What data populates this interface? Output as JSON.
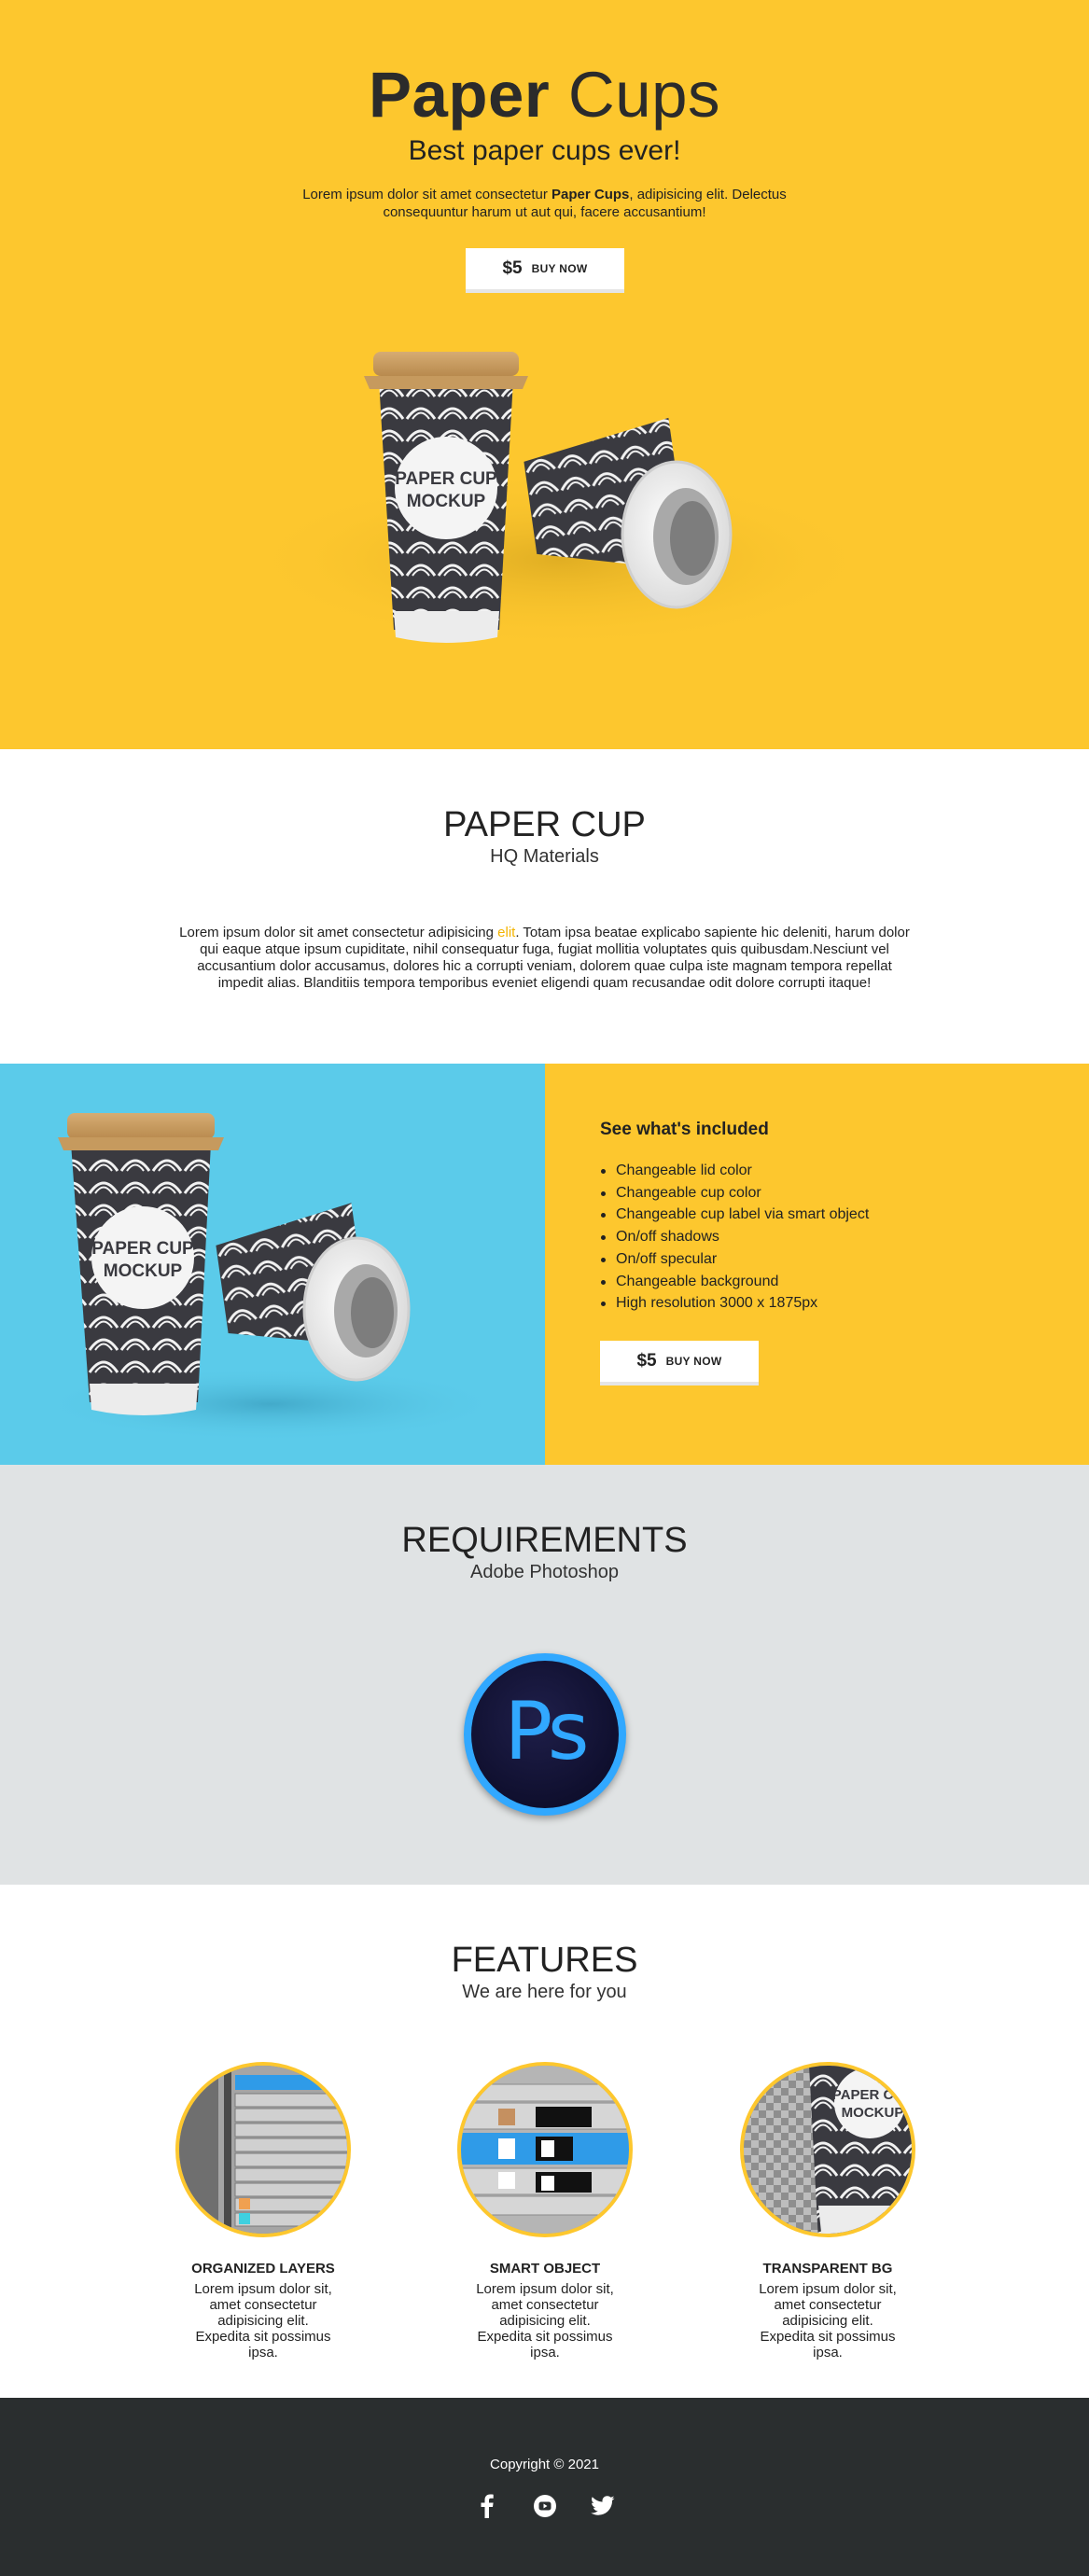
{
  "hero": {
    "title_bold": "Paper",
    "title_rest": " Cups",
    "subtitle": "Best paper cups ever!",
    "lead_pre": "Lorem ipsum dolor sit amet consectetur ",
    "lead_bold": "Paper Cups",
    "lead_post": ", adipisicing elit. Delectus consequuntur harum ut aut qui, facere accusantium!",
    "buy_price": "$5",
    "buy_label": "BUY NOW",
    "cup_label_line1": "PAPER CUP",
    "cup_label_line2": "MOCKUP"
  },
  "about": {
    "title": "PAPER CUP",
    "subtitle": "HQ Materials",
    "para_pre": "Lorem ipsum dolor sit amet consectetur adipisicing ",
    "para_highlight": "elit",
    "para_post": ". Totam ipsa beatae explicabo sapiente hic deleniti, harum dolor qui eaque atque ipsum cupiditate, nihil consequatur fuga, fugiat mollitia voluptates quis quibusdam.Nesciunt vel accusantium dolor accusamus, dolores hic a corrupti veniam, dolorem quae culpa iste magnam tempora repellat impedit alias. Blanditiis tempora temporibus eveniet eligendi quam recusandae odit dolore corrupti itaque!"
  },
  "included": {
    "title": "See what's included",
    "items": [
      "Changeable lid color",
      "Changeable cup color",
      "Changeable cup label via smart object",
      "On/off shadows",
      "On/off specular",
      "Changeable background",
      "High resolution 3000 x 1875px"
    ],
    "buy_price": "$5",
    "buy_label": "BUY NOW"
  },
  "requirements": {
    "title": "REQUIREMENTS",
    "subtitle": "Adobe Photoshop",
    "ps_icon_text": "Ps"
  },
  "features": {
    "title": "FEATURES",
    "subtitle": "We are here for you",
    "items": [
      {
        "title": "ORGANIZED LAYERS",
        "text": "Lorem ipsum dolor sit, amet consectetur adipisicing elit. Expedita sit possimus ipsa."
      },
      {
        "title": "SMART OBJECT",
        "text": "Lorem ipsum dolor sit, amet consectetur adipisicing elit. Expedita sit possimus ipsa."
      },
      {
        "title": "TRANSPARENT BG",
        "text": "Lorem ipsum dolor sit, amet consectetur adipisicing elit. Expedita sit possimus ipsa."
      }
    ]
  },
  "footer": {
    "copyright": "Copyright © 2021",
    "socials": [
      "facebook-icon",
      "youtube-icon",
      "twitter-icon"
    ]
  },
  "colors": {
    "yellow": "#fdc72e",
    "blue": "#5bcbea",
    "grey": "#e0e3e4",
    "dark": "#2a2e2f",
    "ps_blue": "#31a8ff"
  }
}
